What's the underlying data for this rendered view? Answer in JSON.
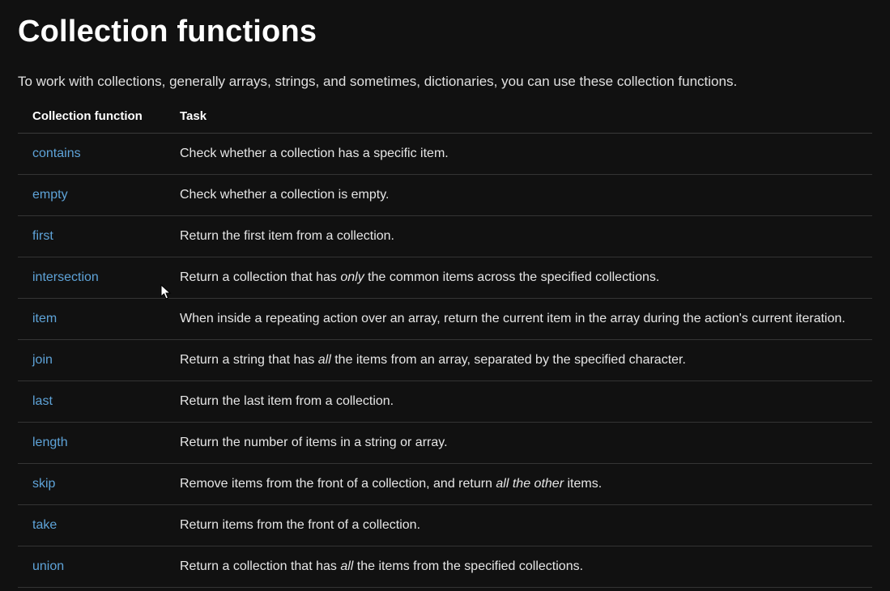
{
  "heading": "Collection functions",
  "intro": "To work with collections, generally arrays, strings, and sometimes, dictionaries, you can use these collection functions.",
  "columns": {
    "fn": "Collection function",
    "task": "Task"
  },
  "rows": [
    {
      "fn": "contains",
      "task_parts": [
        {
          "t": "Check whether a collection has a specific item."
        }
      ]
    },
    {
      "fn": "empty",
      "task_parts": [
        {
          "t": "Check whether a collection is empty."
        }
      ]
    },
    {
      "fn": "first",
      "task_parts": [
        {
          "t": "Return the first item from a collection."
        }
      ]
    },
    {
      "fn": "intersection",
      "task_parts": [
        {
          "t": "Return a collection that has "
        },
        {
          "t": "only",
          "italic": true
        },
        {
          "t": " the common items across the specified collections."
        }
      ]
    },
    {
      "fn": "item",
      "task_parts": [
        {
          "t": "When inside a repeating action over an array, return the current item in the array during the action's current iteration."
        }
      ]
    },
    {
      "fn": "join",
      "task_parts": [
        {
          "t": "Return a string that has "
        },
        {
          "t": "all",
          "italic": true
        },
        {
          "t": " the items from an array, separated by the specified character."
        }
      ]
    },
    {
      "fn": "last",
      "task_parts": [
        {
          "t": "Return the last item from a collection."
        }
      ]
    },
    {
      "fn": "length",
      "task_parts": [
        {
          "t": "Return the number of items in a string or array."
        }
      ]
    },
    {
      "fn": "skip",
      "task_parts": [
        {
          "t": "Remove items from the front of a collection, and return "
        },
        {
          "t": "all the other",
          "italic": true
        },
        {
          "t": " items."
        }
      ]
    },
    {
      "fn": "take",
      "task_parts": [
        {
          "t": "Return items from the front of a collection."
        }
      ]
    },
    {
      "fn": "union",
      "task_parts": [
        {
          "t": "Return a collection that has "
        },
        {
          "t": "all",
          "italic": true
        },
        {
          "t": " the items from the specified collections."
        }
      ]
    }
  ]
}
